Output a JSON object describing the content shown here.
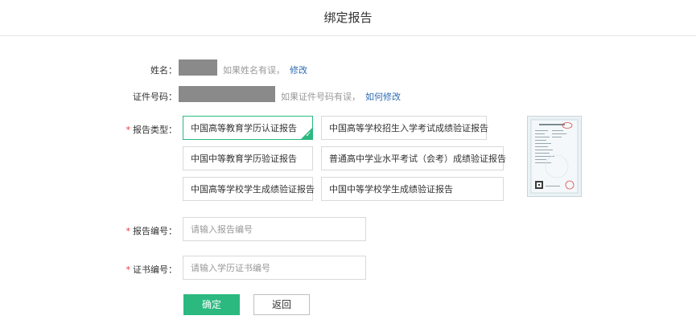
{
  "header": {
    "title": "绑定报告"
  },
  "name_row": {
    "label": "姓名：",
    "hint": "如果姓名有误，",
    "link": "修改"
  },
  "id_row": {
    "label": "证件号码：",
    "hint": "如果证件号码有误，",
    "link": "如何修改"
  },
  "report_type": {
    "required_mark": "*",
    "label": "报告类型：",
    "options": [
      "中国高等教育学历认证报告",
      "中国高等学校招生入学考试成绩验证报告",
      "中国中等教育学历验证报告",
      "普通高中学业水平考试（会考）成绩验证报告",
      "中国高等学校学生成绩验证报告",
      "中国中等学校学生成绩验证报告"
    ],
    "selected_index": 0
  },
  "report_no": {
    "required_mark": "*",
    "label": "报告编号：",
    "placeholder": "请输入报告编号"
  },
  "cert_no": {
    "required_mark": "*",
    "label": "证书编号：",
    "placeholder": "请输入学历证书编号"
  },
  "buttons": {
    "confirm": "确定",
    "back": "返回"
  },
  "colors": {
    "accent": "#2bb980",
    "link": "#2d6bb3",
    "required": "#e4393c"
  }
}
